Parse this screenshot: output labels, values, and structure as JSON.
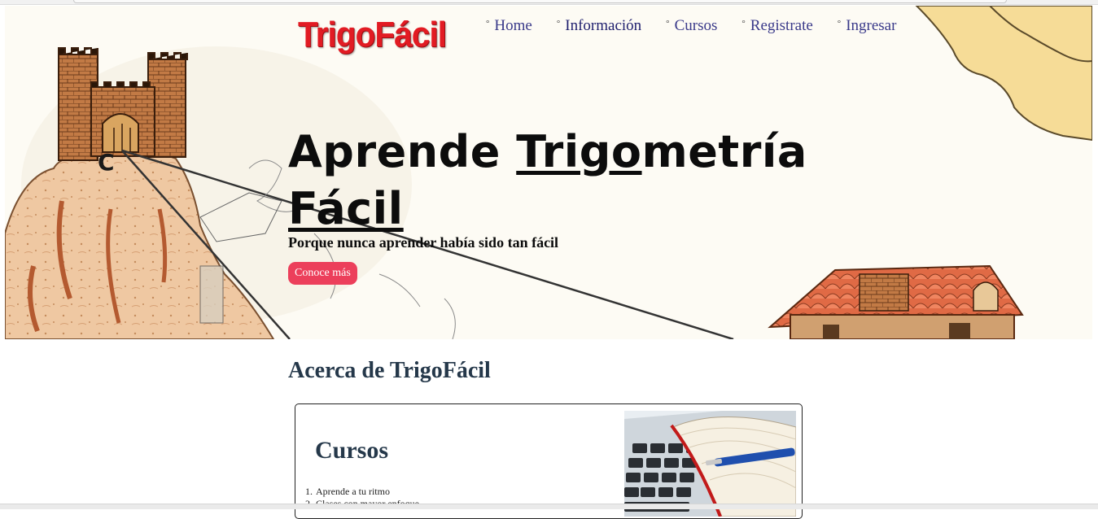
{
  "header": {
    "logo_text": "TrigoFácil",
    "nav": [
      {
        "label": "Home"
      },
      {
        "label": "Información"
      },
      {
        "label": "Cursos"
      },
      {
        "label": "Registrate"
      },
      {
        "label": "Ingresar"
      }
    ],
    "bullet": "°"
  },
  "hero": {
    "headline_part1": "Aprende ",
    "headline_trigo": "Trigo",
    "headline_part2": "metría",
    "headline_line2": "Fácil",
    "subtitle": "Porque nunca aprender había sido tan fácil",
    "cta_label": "Conoce más",
    "castle_letter": "C"
  },
  "about": {
    "title": "Acerca de TrigoFácil",
    "card": {
      "title": "Cursos",
      "items": [
        {
          "num": "1.",
          "text": "Aprende a tu ritmo"
        },
        {
          "num": "2.",
          "text": "Clases con mayor enfoque"
        }
      ]
    }
  },
  "colors": {
    "logo": "#e21b23",
    "cta": "#ec3f5b",
    "nav_text": "#3a3a8a",
    "headings": "#25384a"
  },
  "icons": {
    "nav_bullet": "bullet-icon"
  }
}
